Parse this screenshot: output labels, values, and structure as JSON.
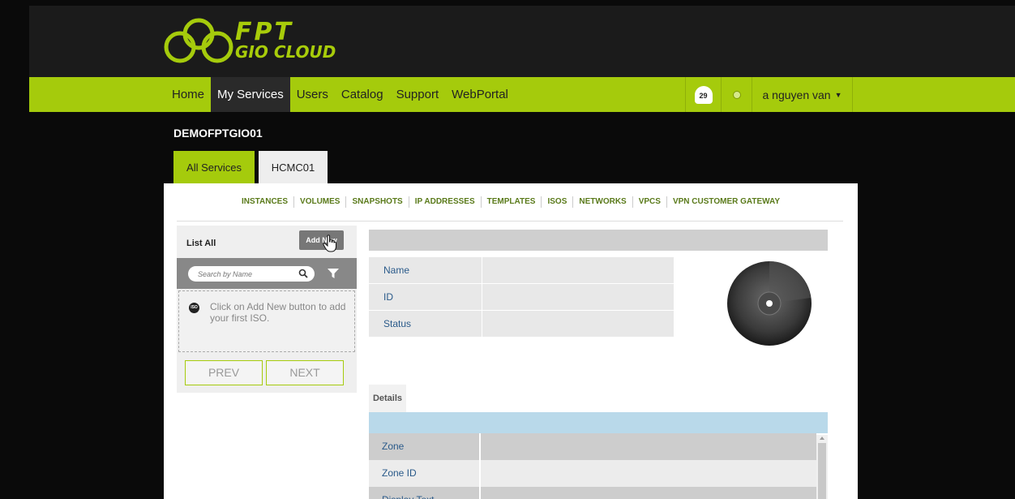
{
  "brand": {
    "line1": "FPT",
    "line2": "GIO CLOUD",
    "color": "#a5cb0c"
  },
  "nav": {
    "items": [
      {
        "label": "Home",
        "active": false
      },
      {
        "label": "My Services",
        "active": true
      },
      {
        "label": "Users",
        "active": false
      },
      {
        "label": "Catalog",
        "active": false
      },
      {
        "label": "Support",
        "active": false
      },
      {
        "label": "WebPortal",
        "active": false
      }
    ],
    "notifications_count": "29",
    "user": "a nguyen van"
  },
  "domain_name": "DEMOFPTGIO01",
  "zone_tabs": [
    {
      "label": "All Services",
      "active": true
    },
    {
      "label": "HCMC01",
      "active": false
    }
  ],
  "subnav": [
    "INSTANCES",
    "VOLUMES",
    "SNAPSHOTS",
    "IP ADDRESSES",
    "TEMPLATES",
    "ISOS",
    "NETWORKS",
    "VPCS",
    "VPN CUSTOMER GATEWAY"
  ],
  "list": {
    "title": "List All",
    "add_new": "Add New",
    "search_placeholder": "Search by Name",
    "empty_icon_text": "ISO",
    "empty_message": "Click on Add New button to add your first ISO.",
    "prev": "PREV",
    "next": "NEXT"
  },
  "info": {
    "rows": [
      {
        "label": "Name",
        "value": ""
      },
      {
        "label": "ID",
        "value": ""
      },
      {
        "label": "Status",
        "value": ""
      }
    ]
  },
  "details": {
    "tab": "Details",
    "rows": [
      {
        "label": "Zone",
        "value": ""
      },
      {
        "label": "Zone ID",
        "value": ""
      },
      {
        "label": "Display Text",
        "value": ""
      }
    ]
  }
}
